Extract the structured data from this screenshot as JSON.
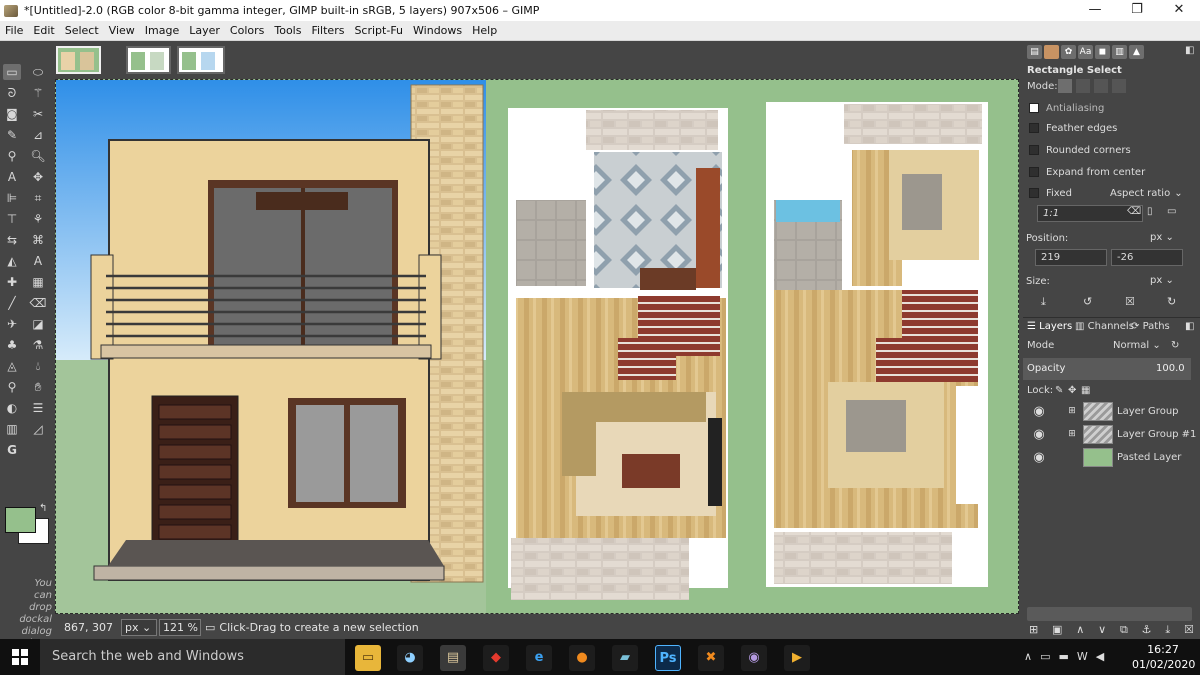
{
  "window": {
    "title": "*[Untitled]-2.0 (RGB color 8-bit gamma integer, GIMP built-in sRGB, 5 layers) 907x506 – GIMP"
  },
  "menu": [
    "File",
    "Edit",
    "Select",
    "View",
    "Image",
    "Layer",
    "Colors",
    "Tools",
    "Filters",
    "Script-Fu",
    "Windows",
    "Help"
  ],
  "toolbox": {
    "dock_hint": "You\ncan\ndrop\ndockal\ndialog\nhere",
    "fg_color": "#95c08c",
    "bg_color": "#ffffff"
  },
  "statusbar": {
    "coords": "867, 307",
    "unit": "px",
    "zoom": "121 %",
    "message": "Click-Drag to create a new selection"
  },
  "tool_options": {
    "title": "Rectangle Select",
    "mode_label": "Mode:",
    "antialiasing": "Antialiasing",
    "feather": "Feather edges",
    "rounded": "Rounded corners",
    "expand": "Expand from center",
    "fixed": "Fixed",
    "fixed_mode": "Aspect ratio",
    "ratio": "1:1",
    "position_label": "Position:",
    "position_unit": "px",
    "pos_x": "219",
    "pos_y": "-26",
    "size_label": "Size:",
    "size_unit": "px"
  },
  "layers_panel": {
    "tabs": [
      "Layers",
      "Channels",
      "Paths"
    ],
    "mode_label": "Mode",
    "mode_value": "Normal",
    "opacity_label": "Opacity",
    "opacity_value": "100.0",
    "lock_label": "Lock:",
    "layers": [
      {
        "name": "Layer Group"
      },
      {
        "name": "Layer Group #1"
      },
      {
        "name": "Pasted Layer"
      }
    ]
  },
  "taskbar": {
    "search": "Search the web and Windows",
    "time": "16:27",
    "date": "01/02/2020",
    "ps_label": "Ps"
  },
  "colors": {
    "canvas_bg": "#95c08c",
    "ui_dark": "#454545"
  }
}
